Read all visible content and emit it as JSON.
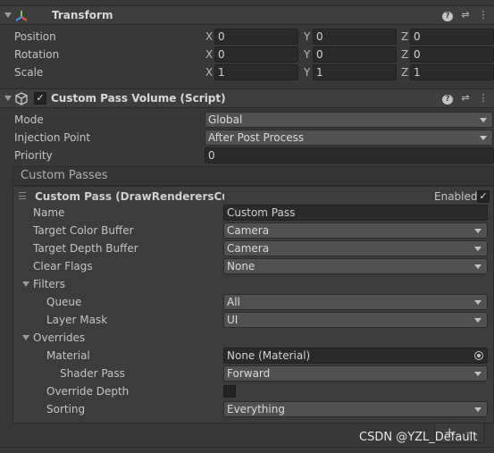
{
  "transform": {
    "title": "Transform",
    "rows": [
      {
        "label": "Position",
        "x": "0",
        "y": "0",
        "z": "0"
      },
      {
        "label": "Rotation",
        "x": "0",
        "y": "0",
        "z": "0"
      },
      {
        "label": "Scale",
        "x": "1",
        "y": "1",
        "z": "1"
      }
    ],
    "axis": {
      "x": "X",
      "y": "Y",
      "z": "Z"
    }
  },
  "component": {
    "title": "Custom Pass Volume (Script)",
    "enabled": true,
    "mode_label": "Mode",
    "mode_value": "Global",
    "injection_label": "Injection Point",
    "injection_value": "After Post Process",
    "priority_label": "Priority",
    "priority_value": "0"
  },
  "custom_passes": {
    "header": "Custom Passes",
    "pass_title": "Custom Pass (DrawRenderersCusto",
    "enabled_label": "Enabled",
    "enabled": true,
    "name_label": "Name",
    "name_value": "Custom Pass",
    "color_buffer_label": "Target Color Buffer",
    "color_buffer_value": "Camera",
    "depth_buffer_label": "Target Depth Buffer",
    "depth_buffer_value": "Camera",
    "clear_flags_label": "Clear Flags",
    "clear_flags_value": "None",
    "filters_label": "Filters",
    "queue_label": "Queue",
    "queue_value": "All",
    "layer_mask_label": "Layer Mask",
    "layer_mask_value": "UI",
    "overrides_label": "Overrides",
    "material_label": "Material",
    "material_value": "None (Material)",
    "shader_pass_label": "Shader Pass",
    "shader_pass_value": "Forward",
    "override_depth_label": "Override Depth",
    "override_depth": false,
    "sorting_label": "Sorting",
    "sorting_value": "Everything"
  },
  "list_controls": {
    "add": "+",
    "remove": "−"
  },
  "watermark": "CSDN @YZL_Default",
  "icons": {
    "help": "help-icon",
    "presets": "presets-icon",
    "more": "more-icon",
    "transform": "transform-axes-icon",
    "script": "script-component-icon",
    "object_picker": "object-picker-icon"
  }
}
